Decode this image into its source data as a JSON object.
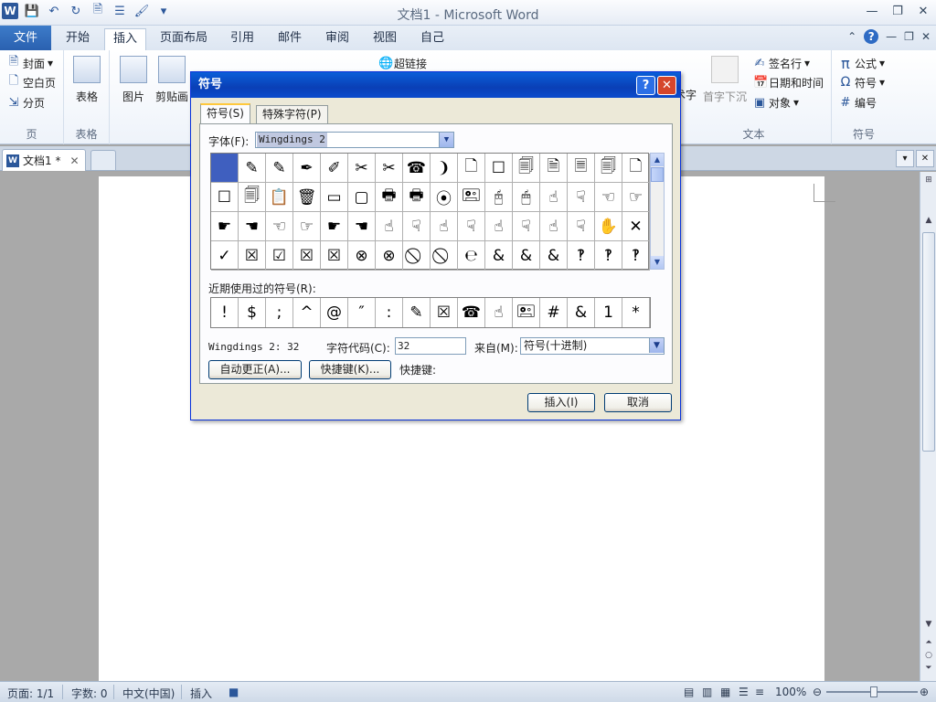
{
  "window": {
    "title": "文档1 - Microsoft Word",
    "app_icon": "W",
    "controls": [
      "minimize-icon",
      "restore-icon",
      "close-icon"
    ]
  },
  "ribbon_tabs": [
    "文件",
    "开始",
    "插入",
    "页面布局",
    "引用",
    "邮件",
    "审阅",
    "视图",
    "自己"
  ],
  "active_tab": "插入",
  "ribbon": {
    "pages_group": {
      "items": [
        "封面",
        "空白页",
        "分页"
      ],
      "label": "页"
    },
    "tables_group": {
      "item": "表格",
      "label": "表格"
    },
    "illustrations": {
      "picture": "图片",
      "clipart": "剪贴画"
    },
    "hyperlink": "超链接",
    "text_group": {
      "wordart_partial": "术字",
      "dropcap": "首字下沉",
      "label": "文本",
      "signature": "签名行",
      "datetime": "日期和时间",
      "object": "对象"
    },
    "symbols_group": {
      "equation": "公式",
      "symbol": "符号",
      "number": "编号",
      "label": "符号",
      "pi": "π",
      "omega": "Ω"
    }
  },
  "document_tab": {
    "name": "文档1 *"
  },
  "status_bar": {
    "page": "页面: 1/1",
    "words": "字数: 0",
    "language": "中文(中国)",
    "mode": "插入",
    "zoom": "100%"
  },
  "dialog": {
    "title": "符号",
    "tab_symbols": "符号(S)",
    "tab_special": "特殊字符(P)",
    "font_label": "字体(F):",
    "font_value": "Wingdings 2",
    "grid_rows": [
      [
        "",
        "✎",
        "✎",
        "✒",
        "✐",
        "✂",
        "✂",
        "☎",
        "❩",
        "🗋",
        "☐",
        "🗐",
        "🗎",
        "🗏",
        "🗐",
        "🗋"
      ],
      [
        "☐",
        "🗐",
        "📋",
        "🗑",
        "▭",
        "▢",
        "🖶",
        "🖶",
        "⦿",
        "🖭",
        "🖰",
        "🖱",
        "☝",
        "☟",
        "☜",
        "☞"
      ],
      [
        "☛",
        "☚",
        "☜",
        "☞",
        "☛",
        "☚",
        "☝",
        "☟",
        "☝",
        "☟",
        "☝",
        "☟",
        "☝",
        "☟",
        "✋",
        "✕"
      ],
      [
        "✓",
        "☒",
        "☑",
        "☒",
        "☒",
        "⊗",
        "⊗",
        "⃠",
        "⃠",
        "℮",
        "&",
        "&",
        "&",
        "‽",
        "‽",
        "‽"
      ]
    ],
    "recent_label": "近期使用过的符号(R):",
    "recent": [
      "!",
      "$",
      ";",
      "^",
      "@",
      "″",
      ":",
      "✎",
      "☒",
      "☎",
      "☝",
      "🖭",
      "#",
      "&",
      "1",
      "*"
    ],
    "char_info": "Wingdings 2: 32",
    "code_label": "字符代码(C):",
    "code_value": "32",
    "from_label": "来自(M):",
    "from_value": "符号(十进制)",
    "autocorrect_button": "自动更正(A)...",
    "shortcut_button": "快捷键(K)...",
    "shortcut_label": "快捷键:",
    "insert_button": "插入(I)",
    "cancel_button": "取消"
  }
}
